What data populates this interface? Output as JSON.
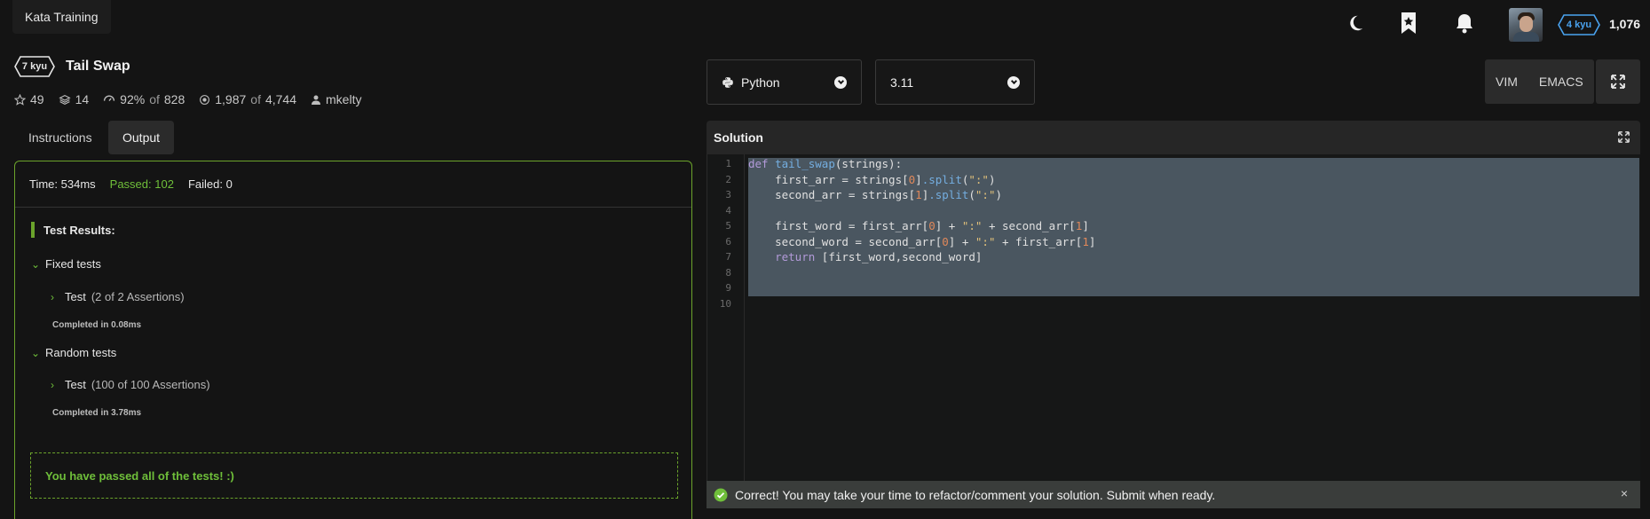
{
  "topbar": {
    "brand": "Kata Training",
    "rank_badge": "4 kyu",
    "honor": "1,076",
    "icons": [
      "moon-icon",
      "bookmark-star-icon",
      "bell-icon"
    ]
  },
  "kata": {
    "kyu": "7 kyu",
    "title": "Tail Swap",
    "stars": "49",
    "collections": "14",
    "satisfaction_pct": "92%",
    "satisfaction_of": "of",
    "satisfaction_votes": "828",
    "completed": "1,987",
    "completed_of": "of",
    "completed_total": "4,744",
    "author": "mkelty"
  },
  "tabs": [
    {
      "label": "Instructions",
      "active": false
    },
    {
      "label": "Output",
      "active": true
    }
  ],
  "output": {
    "time": "Time: 534ms",
    "passed": "Passed: 102",
    "failed": "Failed: 0",
    "results_title": "Test Results:",
    "groups": [
      {
        "label": "Fixed tests",
        "test": "Test",
        "assertions": "(2 of 2 Assertions)",
        "completed": "Completed in 0.08ms"
      },
      {
        "label": "Random tests",
        "test": "Test",
        "assertions": "(100 of 100 Assertions)",
        "completed": "Completed in 3.78ms"
      }
    ],
    "pass_message": "You have passed all of the tests! :)"
  },
  "editor": {
    "language": "Python",
    "version": "3.11",
    "modes": [
      "VIM",
      "EMACS"
    ],
    "panel_title": "Solution",
    "line_numbers": [
      "1",
      "2",
      "3",
      "4",
      "5",
      "6",
      "7",
      "8",
      "9",
      "10"
    ],
    "code_lines": [
      "def tail_swap(strings):",
      "    first_arr = strings[0].split(\":\")",
      "    second_arr = strings[1].split(\":\")",
      "",
      "    first_word = first_arr[0] + \":\" + second_arr[1]",
      "    second_word = second_arr[0] + \":\" + first_arr[1]",
      "    return [first_word,second_word]",
      "",
      "",
      ""
    ]
  },
  "toast": {
    "message": "Correct! You may take your time to refactor/comment your solution. Submit when ready.",
    "close": "×"
  },
  "colors": {
    "accent_green": "#6ba32b",
    "pass_text": "#6fbf3a",
    "rank_blue": "#4aa3f0",
    "selection": "#4a5660"
  }
}
